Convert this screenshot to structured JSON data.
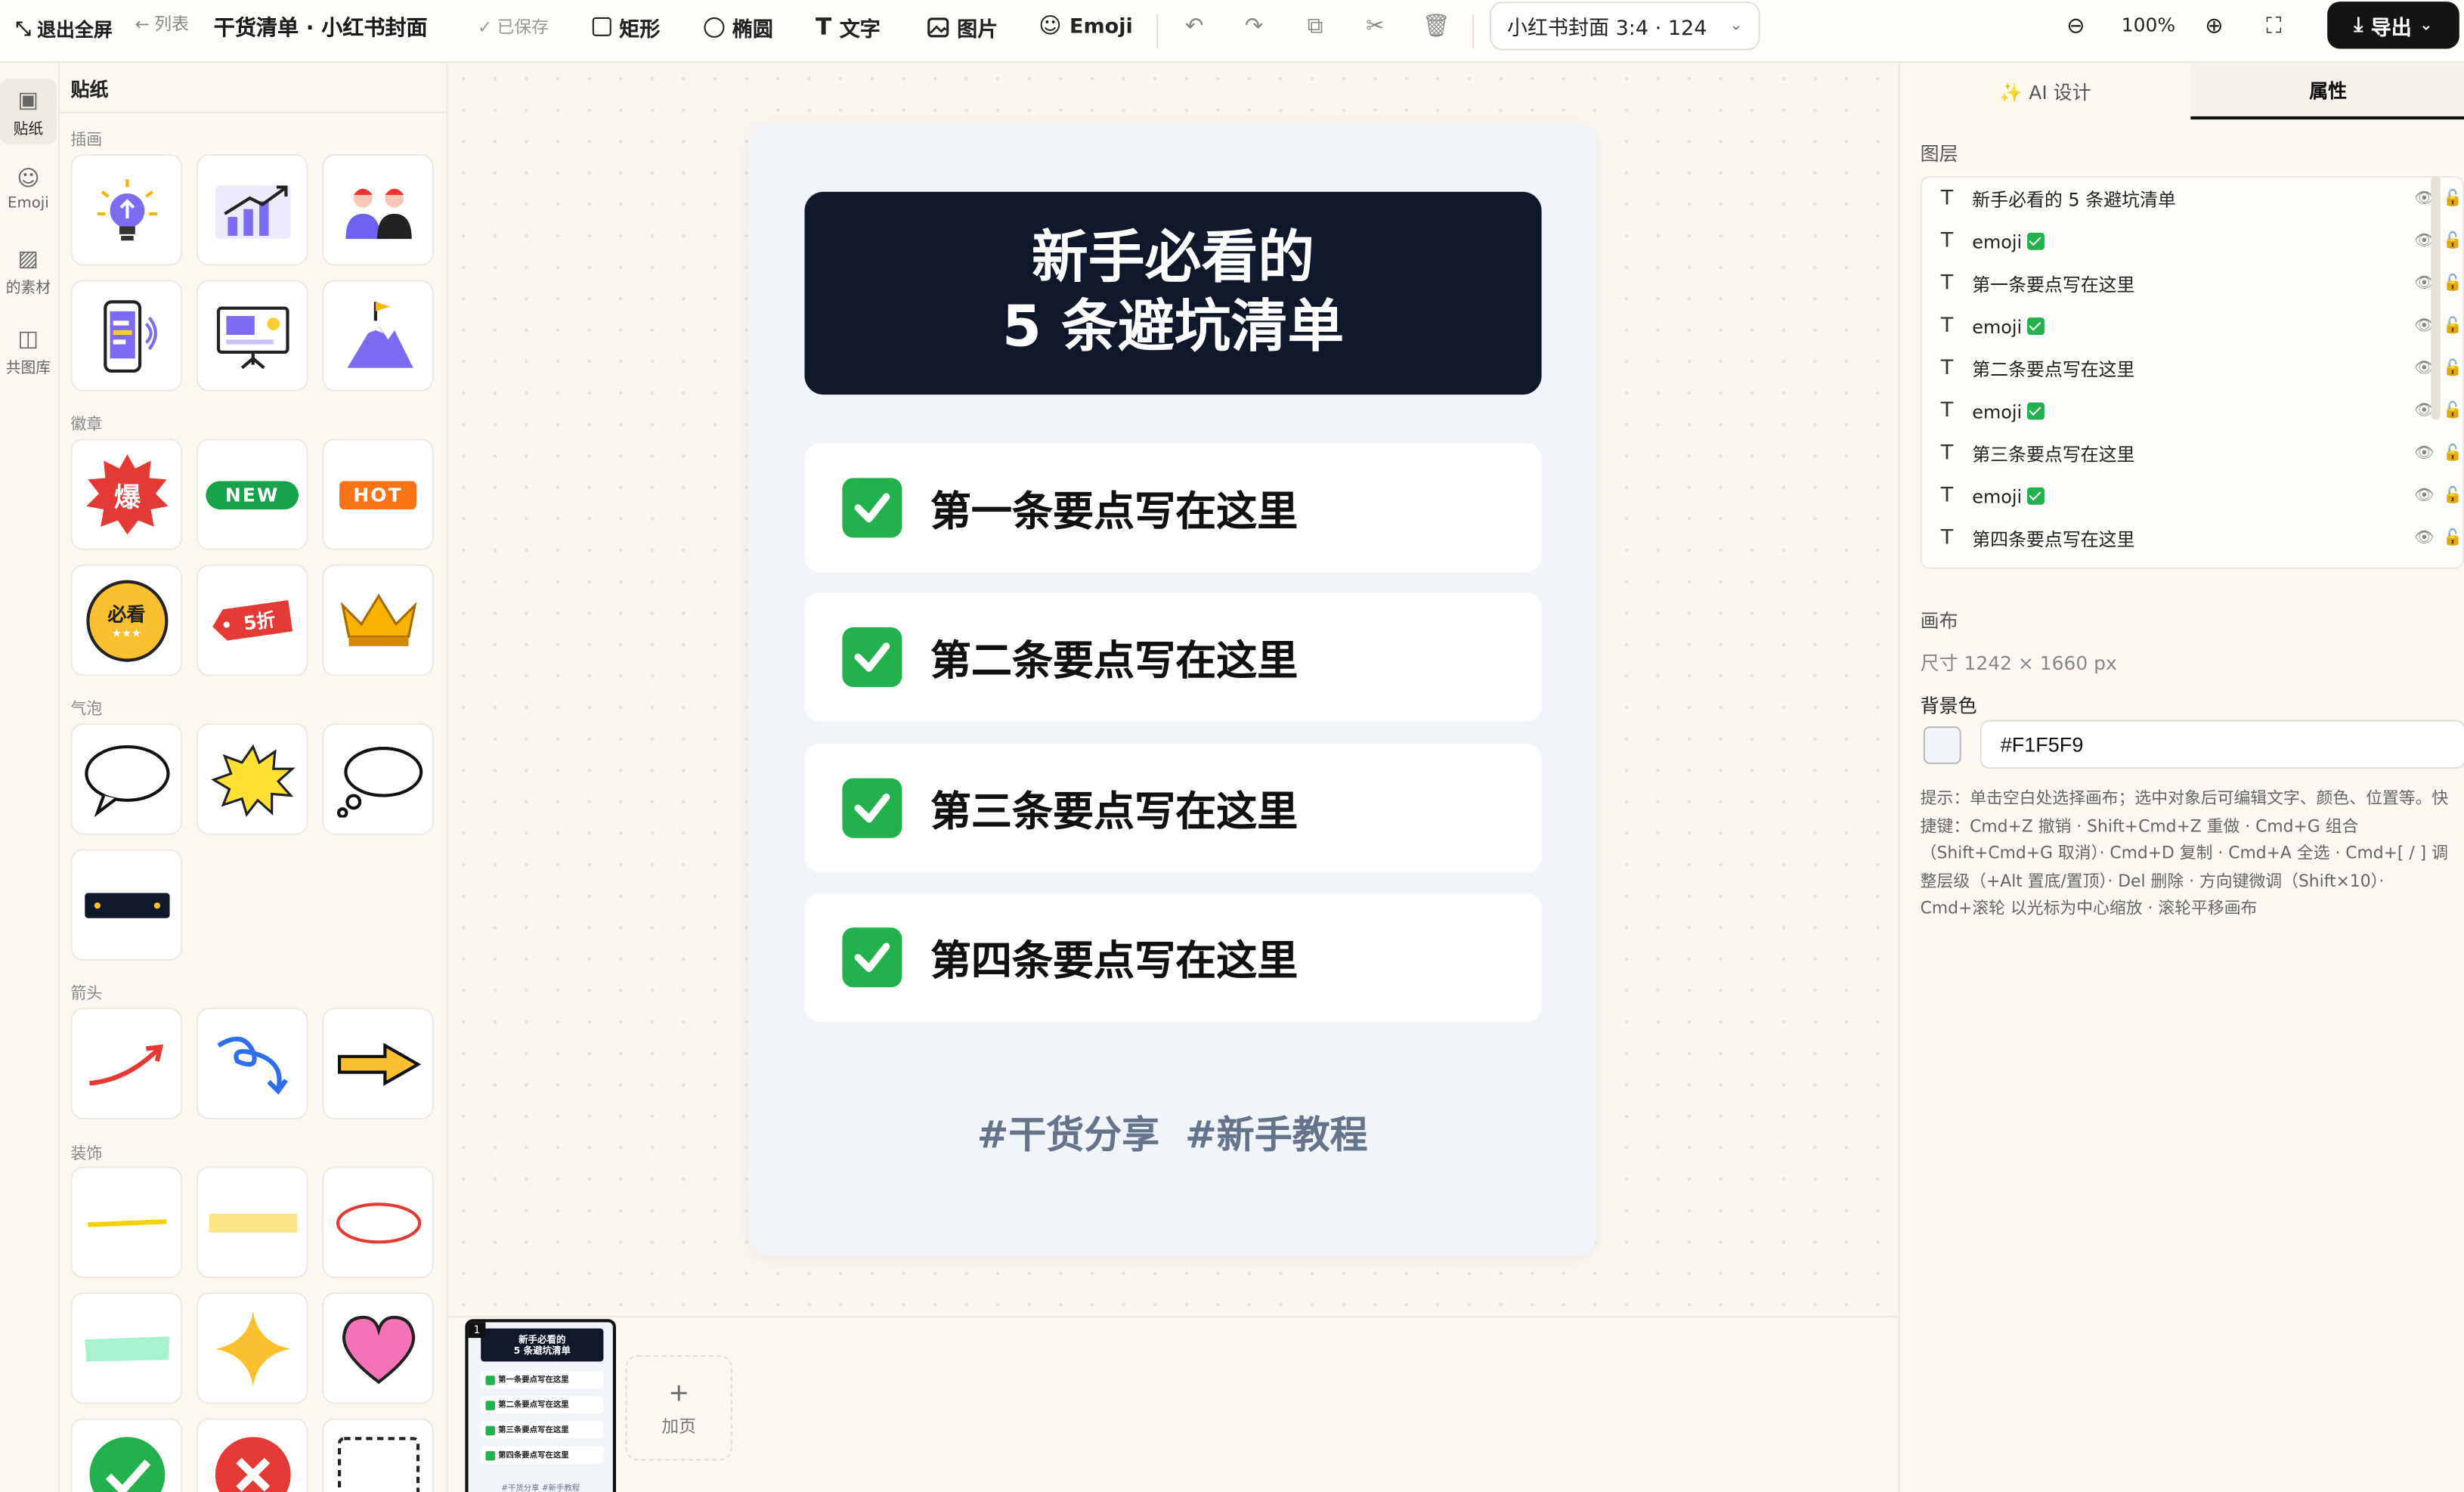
{
  "toolbar": {
    "exit": "退出全屏",
    "back": "列表",
    "title": "干货清单 · 小红书封面",
    "saved": "已保存",
    "tools": {
      "rect": "矩形",
      "ellipse": "椭圆",
      "text": "文字",
      "image": "图片",
      "emoji": "Emoji"
    },
    "preset": "小红书封面 3:4 · 124",
    "zoom": "100%",
    "export": "导出"
  },
  "rail": {
    "stickers": "贴纸",
    "emoji": "Emoji",
    "mine": "的素材",
    "shared": "共图库"
  },
  "left_panel": {
    "title": "贴纸",
    "categories": {
      "illustration": "插画",
      "badge": "徽章",
      "bubble": "气泡",
      "arrow": "箭头",
      "decor": "装饰"
    },
    "badges": {
      "hot_fire": "爆",
      "new": "NEW",
      "hot": "HOT",
      "must": "必看",
      "sale": "5折"
    }
  },
  "page": {
    "title_line1": "新手必看的",
    "title_line2": "5 条避坑清单",
    "items": [
      "第一条要点写在这里",
      "第二条要点写在这里",
      "第三条要点写在这里",
      "第四条要点写在这里"
    ],
    "tags": "#干货分享  #新手教程"
  },
  "strip": {
    "page_number": "1",
    "add_page": "加页"
  },
  "right_panel": {
    "tab_ai": "✨ AI 设计",
    "tab_props": "属性",
    "layers_title": "图层",
    "layers": [
      "新手必看的 5 条避坑清单",
      "emoji",
      "第一条要点写在这里",
      "emoji",
      "第二条要点写在这里",
      "emoji",
      "第三条要点写在这里",
      "emoji",
      "第四条要点写在这里"
    ],
    "canvas_title": "画布",
    "size": "尺寸 1242 × 1660 px",
    "bg_label": "背景色",
    "bg_value": "#F1F5F9",
    "tip": "提示：单击空白处选择画布；选中对象后可编辑文字、颜色、位置等。快捷键：Cmd+Z 撤销 · Shift+Cmd+Z 重做 · Cmd+G 组合（Shift+Cmd+G 取消）· Cmd+D 复制 · Cmd+A 全选 · Cmd+[ / ] 调整层级（+Alt 置底/置顶）· Del 删除 · 方向键微调（Shift×10）· Cmd+滚轮 以光标为中心缩放 · 滚轮平移画布"
  },
  "colors": {
    "card_bg": "#F1F5F9",
    "header_bg": "#0F172A",
    "check": "#22B14C",
    "export_btn": "#141414"
  }
}
